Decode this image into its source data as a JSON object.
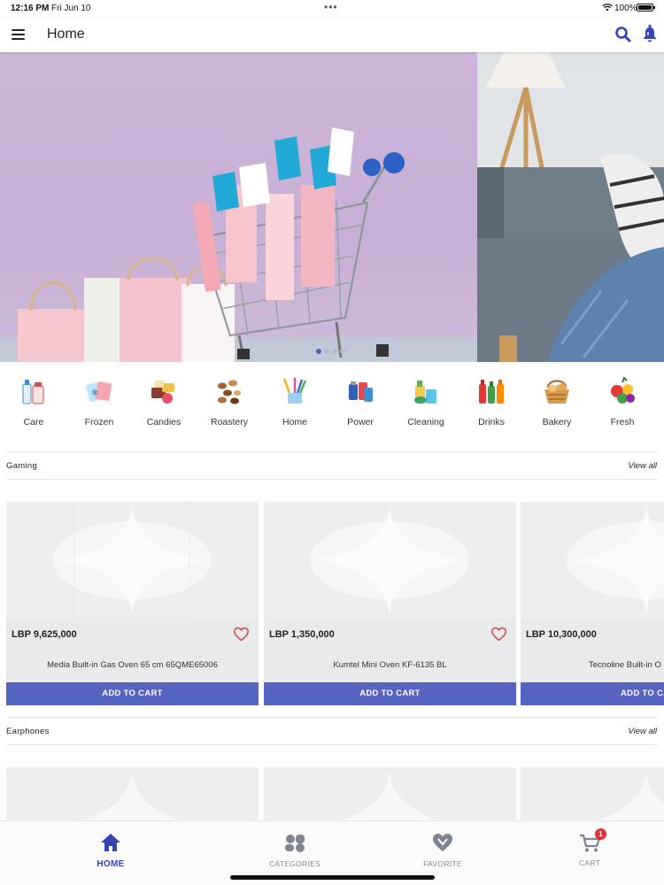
{
  "status_bar": {
    "time": "12:16 PM",
    "date": "Fri Jun 10",
    "battery": "100%"
  },
  "app_bar": {
    "title": "Home"
  },
  "banner": {
    "slides": 4,
    "active_slide": 1
  },
  "categories": [
    {
      "label": "Care",
      "icon": "care-icon"
    },
    {
      "label": "Frozen",
      "icon": "frozen-icon"
    },
    {
      "label": "Candies",
      "icon": "candies-icon"
    },
    {
      "label": "Roastery",
      "icon": "roastery-icon"
    },
    {
      "label": "Home",
      "icon": "home-supplies-icon"
    },
    {
      "label": "Power",
      "icon": "power-icon"
    },
    {
      "label": "Cleaning",
      "icon": "cleaning-icon"
    },
    {
      "label": "Drinks",
      "icon": "drinks-icon"
    },
    {
      "label": "Bakery",
      "icon": "bakery-icon"
    },
    {
      "label": "Fresh",
      "icon": "fresh-icon"
    }
  ],
  "sections": [
    {
      "title": "Gaming",
      "view_all": "View all",
      "products": [
        {
          "price": "LBP 9,625,000",
          "name": "Media Built-in Gas Oven 65 cm 65QME65006",
          "button": "ADD TO CART"
        },
        {
          "price": "LBP 1,350,000",
          "name": "Kumtel Mini Oven KF-6135 BL",
          "button": "ADD TO CART"
        },
        {
          "price": "LBP 10,300,000",
          "name": "Tecnoline Built-in O",
          "button": "ADD TO CA"
        }
      ]
    },
    {
      "title": "Earphones",
      "view_all": "View all"
    }
  ],
  "bottom_nav": {
    "home": "HOME",
    "categories": "CATEGORIES",
    "favorite": "FAVORITE",
    "cart": "CART",
    "cart_count": "1"
  },
  "colors": {
    "accent": "#5563c1",
    "active_nav": "#3645b6",
    "badge": "#e03131",
    "heart": "#d84b4b"
  }
}
